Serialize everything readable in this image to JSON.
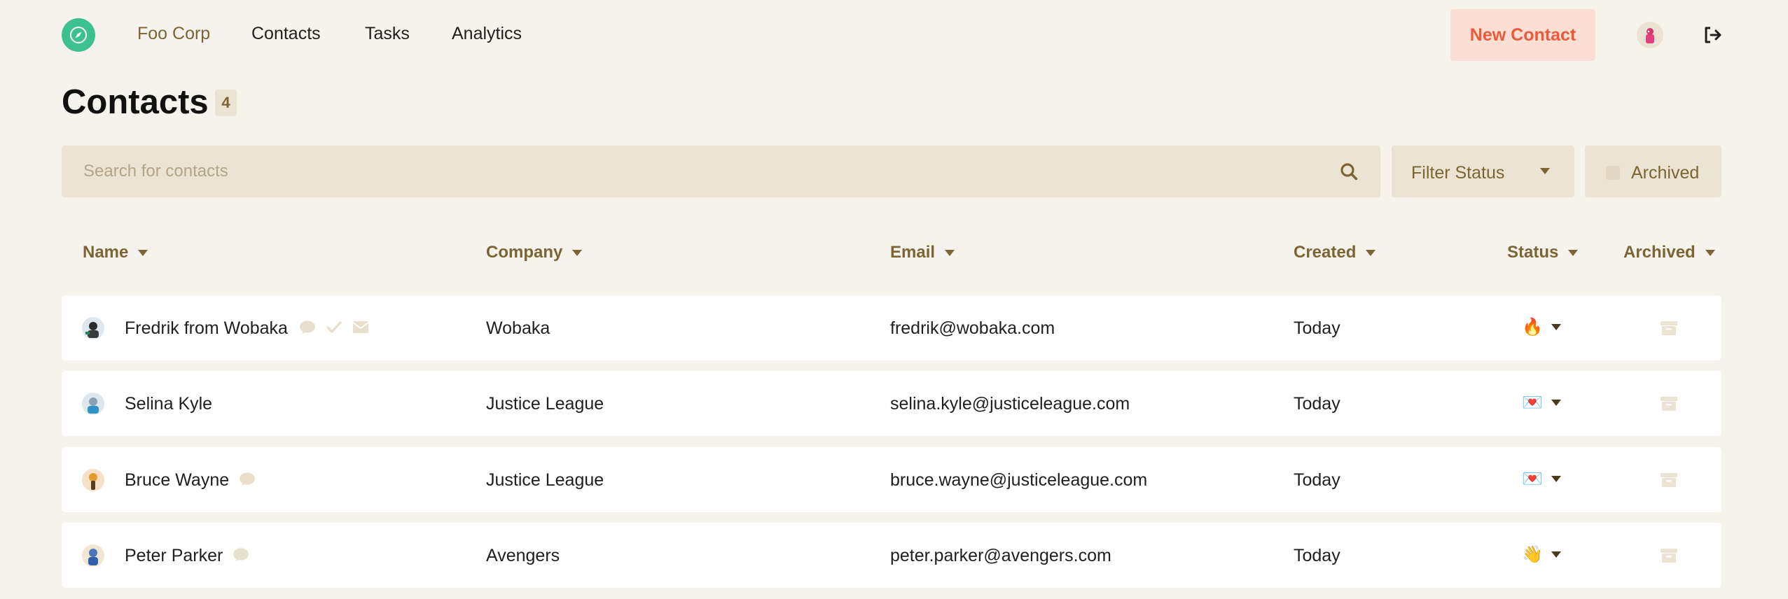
{
  "nav": {
    "brand": "Foo Corp",
    "links": [
      "Contacts",
      "Tasks",
      "Analytics"
    ],
    "new_contact_label": "New Contact"
  },
  "header": {
    "title": "Contacts",
    "count": "4"
  },
  "filters": {
    "search_placeholder": "Search for contacts",
    "status_label": "Filter Status",
    "archived_label": "Archived"
  },
  "table": {
    "columns": [
      "Name",
      "Company",
      "Email",
      "Created",
      "Status",
      "Archived"
    ],
    "rows": [
      {
        "name": "Fredrik from Wobaka",
        "company": "Wobaka",
        "email": "fredrik@wobaka.com",
        "created": "Today",
        "status_emoji": "🔥",
        "icons": [
          "comment",
          "check",
          "mail"
        ]
      },
      {
        "name": "Selina Kyle",
        "company": "Justice League",
        "email": "selina.kyle@justiceleague.com",
        "created": "Today",
        "status_emoji": "💌",
        "icons": []
      },
      {
        "name": "Bruce Wayne",
        "company": "Justice League",
        "email": "bruce.wayne@justiceleague.com",
        "created": "Today",
        "status_emoji": "💌",
        "icons": [
          "comment"
        ]
      },
      {
        "name": "Peter Parker",
        "company": "Avengers",
        "email": "peter.parker@avengers.com",
        "created": "Today",
        "status_emoji": "👋",
        "icons": [
          "comment"
        ]
      }
    ]
  },
  "colors": {
    "background": "#f6f3ec",
    "brand_green": "#3cc08e",
    "accent_brown": "#7d6434",
    "cta_bg": "#fbdfd5",
    "cta_text": "#ec5a3b",
    "field_bg": "#ece4d2"
  }
}
